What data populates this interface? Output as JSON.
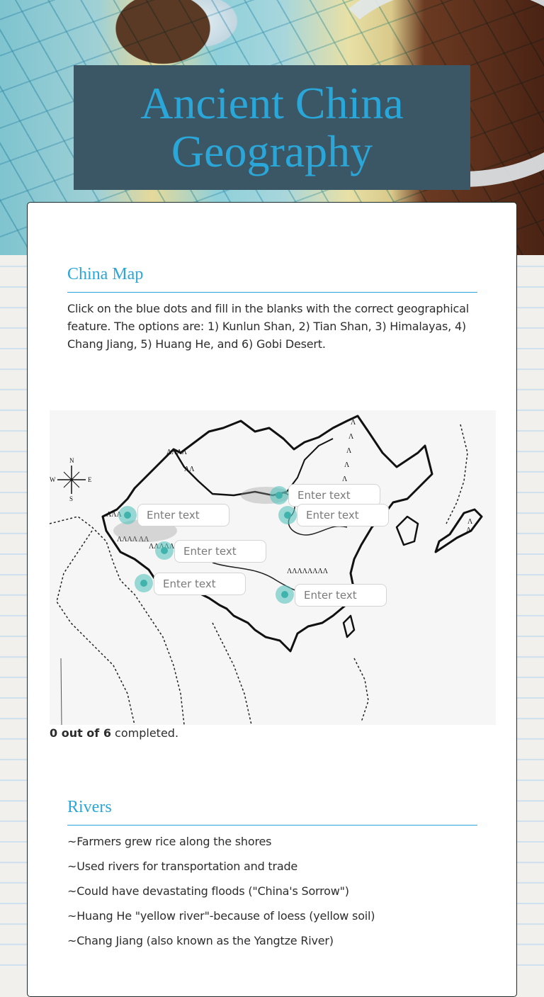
{
  "header": {
    "title": "Ancient China Geography",
    "title_color": "#2aa6d8",
    "title_box_color": "#3b5664"
  },
  "sections": {
    "china_map": {
      "heading": "China Map",
      "instructions": "Click on the blue dots and fill in the blanks with the correct geographical feature.  The options are: 1) Kunlun Shan, 2) Tian Shan, 3) Himalayas, 4) Chang Jiang, 5) Huang He, and 6) Gobi Desert.",
      "map": {
        "compass_labels": {
          "n": "N",
          "s": "S",
          "e": "E",
          "w": "W"
        },
        "blanks": [
          {
            "id": "blank-1",
            "placeholder": "Enter text",
            "value": ""
          },
          {
            "id": "blank-2",
            "placeholder": "Enter text",
            "value": ""
          },
          {
            "id": "blank-3",
            "placeholder": "Enter text",
            "value": ""
          },
          {
            "id": "blank-4",
            "placeholder": "Enter text",
            "value": ""
          },
          {
            "id": "blank-5",
            "placeholder": "Enter text",
            "value": ""
          },
          {
            "id": "blank-6",
            "placeholder": "Enter text",
            "value": ""
          }
        ]
      },
      "progress": {
        "completed": 0,
        "total": 6,
        "bold_text": "0 out of 6",
        "suffix": " completed."
      }
    },
    "rivers": {
      "heading": "Rivers",
      "items": [
        "~Farmers grew rice along the shores",
        "~Used rivers for transportation and trade",
        "~Could have devastating floods (\"China's Sorrow\")",
        "~Huang He \"yellow river\"-because of loess (yellow soil)",
        "~Chang Jiang (also known as the Yangtze River)"
      ]
    }
  },
  "colors": {
    "accent": "#2aa6d8",
    "hotspot": "#3fb3ac",
    "text": "#2d2d2d"
  }
}
